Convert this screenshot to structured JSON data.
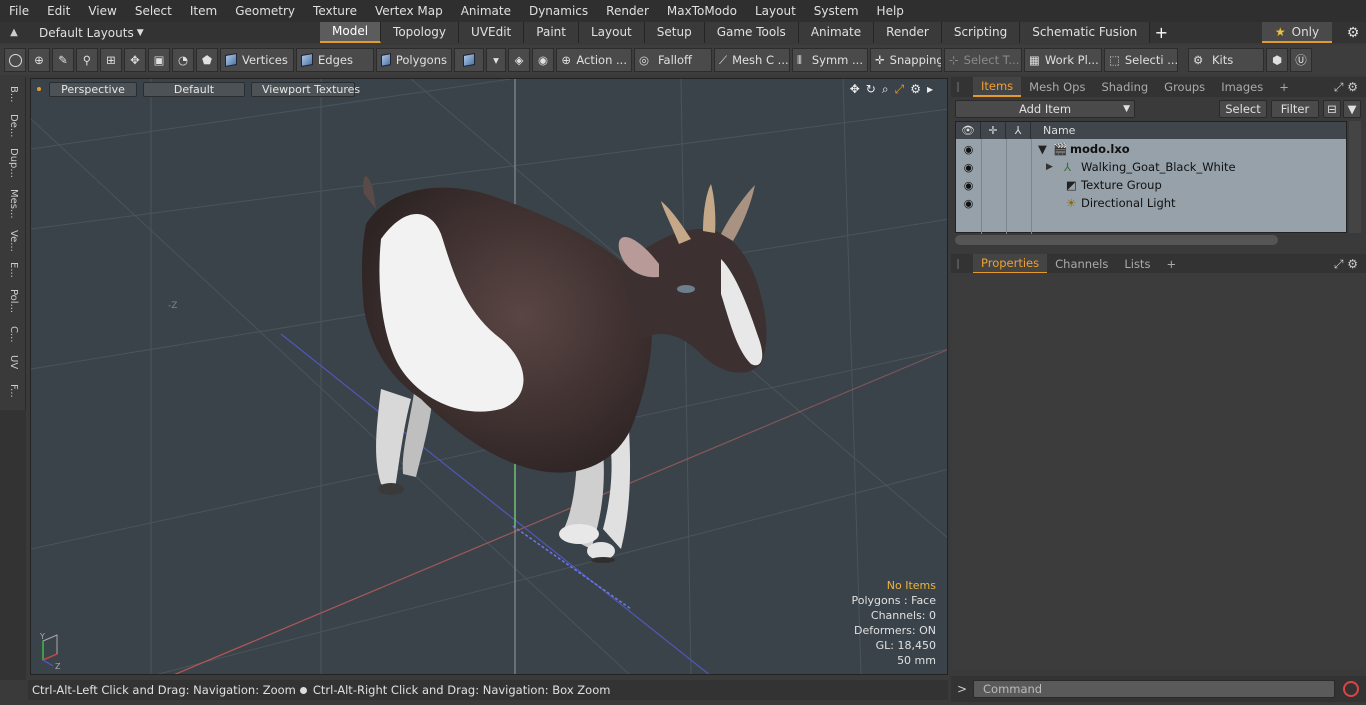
{
  "menu": [
    "File",
    "Edit",
    "View",
    "Select",
    "Item",
    "Geometry",
    "Texture",
    "Vertex Map",
    "Animate",
    "Dynamics",
    "Render",
    "MaxToModo",
    "Layout",
    "System",
    "Help"
  ],
  "layouts": {
    "label": "Default Layouts"
  },
  "tabs": [
    {
      "label": "Model",
      "active": true
    },
    {
      "label": "Topology"
    },
    {
      "label": "UVEdit"
    },
    {
      "label": "Paint"
    },
    {
      "label": "Layout"
    },
    {
      "label": "Setup"
    },
    {
      "label": "Game Tools"
    },
    {
      "label": "Animate"
    },
    {
      "label": "Render"
    },
    {
      "label": "Scripting"
    },
    {
      "label": "Schematic Fusion"
    }
  ],
  "only_label": "Only",
  "toolbar": {
    "vertices": "Vertices",
    "edges": "Edges",
    "polygons": "Polygons",
    "action": "Action ...",
    "falloff": "Falloff",
    "meshc": "Mesh C ...",
    "symm": "Symm ...",
    "snapping": "Snapping",
    "selectt": "Select T...",
    "workpl": "Work Pl...",
    "selecti": "Selecti ...",
    "kits": "Kits"
  },
  "left_tools": [
    "B...",
    "De...",
    "Dup...",
    "Mes...",
    "Ve...",
    "E...",
    "Pol...",
    "C...",
    "UV",
    "F..."
  ],
  "viewport": {
    "view": "Perspective",
    "shading": "Default",
    "textures": "Viewport Textures",
    "axis_label": "-Z",
    "info": {
      "selection": "No Items",
      "polygons": "Polygons : Face",
      "channels": "Channels: 0",
      "deformers": "Deformers: ON",
      "gl": "GL: 18,450",
      "focal": "50 mm"
    }
  },
  "status": {
    "left": "Ctrl-Alt-Left Click and Drag: Navigation: Zoom",
    "right": "Ctrl-Alt-Right Click and Drag: Navigation: Box Zoom"
  },
  "items_panel": {
    "tabs": [
      "Items",
      "Mesh Ops",
      "Shading",
      "Groups",
      "Images"
    ],
    "add_item": "Add Item",
    "select": "Select",
    "filter": "Filter",
    "name_header": "Name",
    "rows": [
      {
        "label": "modo.lxo",
        "bold": true
      },
      {
        "label": "Walking_Goat_Black_White"
      },
      {
        "label": "Texture Group"
      },
      {
        "label": "Directional Light"
      }
    ]
  },
  "props_panel": {
    "tabs": [
      "Properties",
      "Channels",
      "Lists"
    ]
  },
  "command": {
    "placeholder": "Command"
  }
}
